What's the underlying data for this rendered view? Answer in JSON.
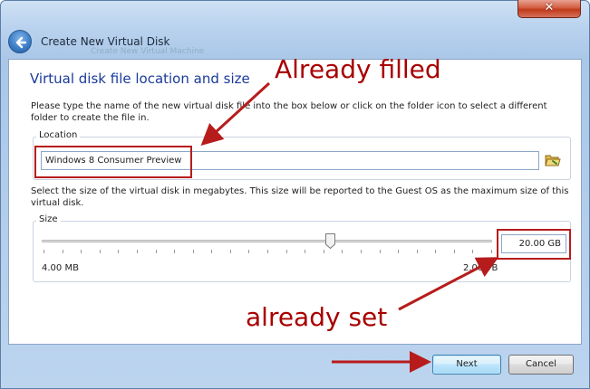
{
  "window": {
    "close_glyph": "✕"
  },
  "header": {
    "title": "Create New Virtual Disk",
    "ghost_text": "Create New Virtual Machine"
  },
  "section": {
    "title": "Virtual disk file location and size",
    "location_description": "Please type the name of the new virtual disk file into the box below or click on the folder icon to select a different folder to create the file in.",
    "size_description": "Select the size of the virtual disk in megabytes. This size will be reported to the Guest OS as the maximum size of this virtual disk."
  },
  "location": {
    "group_label": "Location",
    "value": "Windows 8 Consumer Preview",
    "folder_icon": "folder-open-icon"
  },
  "size": {
    "group_label": "Size",
    "min_label": "4.00 MB",
    "max_label": "2.00 TB",
    "value": "20.00 GB",
    "slider_fraction": 0.64
  },
  "footer": {
    "next_label": "Next",
    "cancel_label": "Cancel"
  },
  "annotations": {
    "filled_text": "Already filled",
    "set_text": "already set",
    "color": "#b71c1c"
  },
  "colors": {
    "title_blue": "#1a3a9a",
    "window_frame": "#aac7e8"
  }
}
